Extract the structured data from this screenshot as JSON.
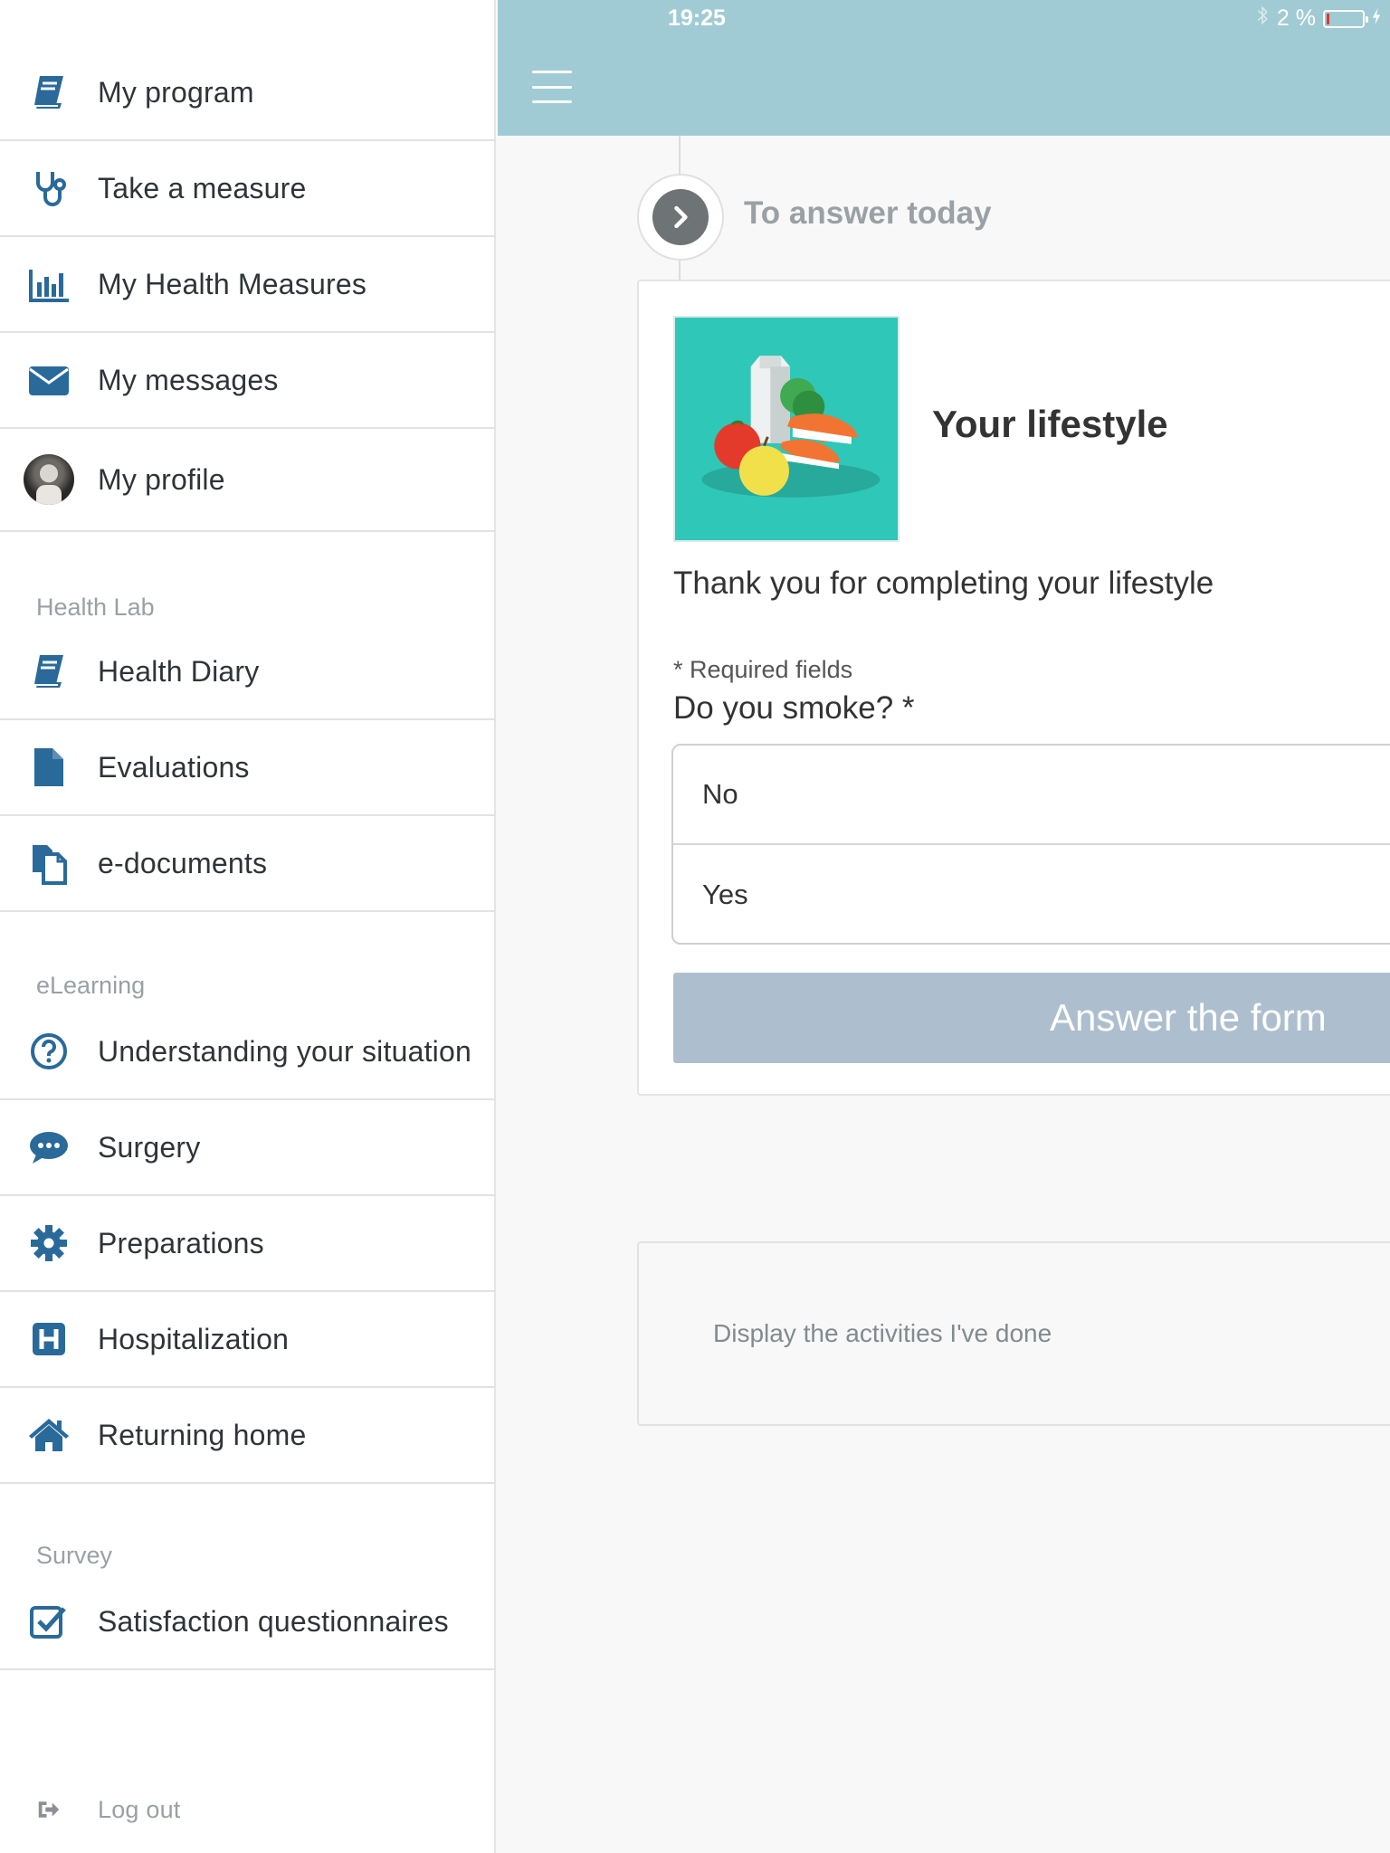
{
  "status_bar": {
    "time": "19:25",
    "battery": "2 %",
    "colors": {
      "bar": "#a1cbd4"
    }
  },
  "sidebar": {
    "items": [
      {
        "label": "My program",
        "icon": "book-icon"
      },
      {
        "label": "Take a measure",
        "icon": "stethoscope-icon"
      },
      {
        "label": "My Health Measures",
        "icon": "bar-chart-icon"
      },
      {
        "label": "My messages",
        "icon": "envelope-icon"
      },
      {
        "label": "My profile",
        "icon": "avatar"
      }
    ],
    "sections": [
      {
        "title": "Health Lab",
        "items": [
          {
            "label": "Health Diary",
            "icon": "book-icon"
          },
          {
            "label": "Evaluations",
            "icon": "file-icon"
          },
          {
            "label": "e-documents",
            "icon": "documents-icon"
          }
        ]
      },
      {
        "title": "eLearning",
        "items": [
          {
            "label": "Understanding your situation",
            "icon": "question-circle-icon"
          },
          {
            "label": "Surgery",
            "icon": "chat-bubble-icon"
          },
          {
            "label": "Preparations",
            "icon": "gear-icon"
          },
          {
            "label": "Hospitalization",
            "icon": "hospital-icon"
          },
          {
            "label": "Returning home",
            "icon": "home-icon"
          }
        ]
      },
      {
        "title": "Survey",
        "items": [
          {
            "label": "Satisfaction questionnaires",
            "icon": "checkbox-icon"
          }
        ]
      }
    ],
    "logout_label": "Log out"
  },
  "main": {
    "section_heading": "To answer today",
    "card": {
      "title": "Your lifestyle",
      "description": "Thank you for completing your lifestyle",
      "required_note": "* Required fields",
      "question": "Do you smoke? *",
      "options": [
        "No",
        "Yes"
      ],
      "submit_label": "Answer the form"
    },
    "activities_link": "Display the activities I've done"
  },
  "colors": {
    "icon": "#2a6a9a",
    "accent_button": "#adbfce",
    "image_bg": "#2fc7b8"
  }
}
